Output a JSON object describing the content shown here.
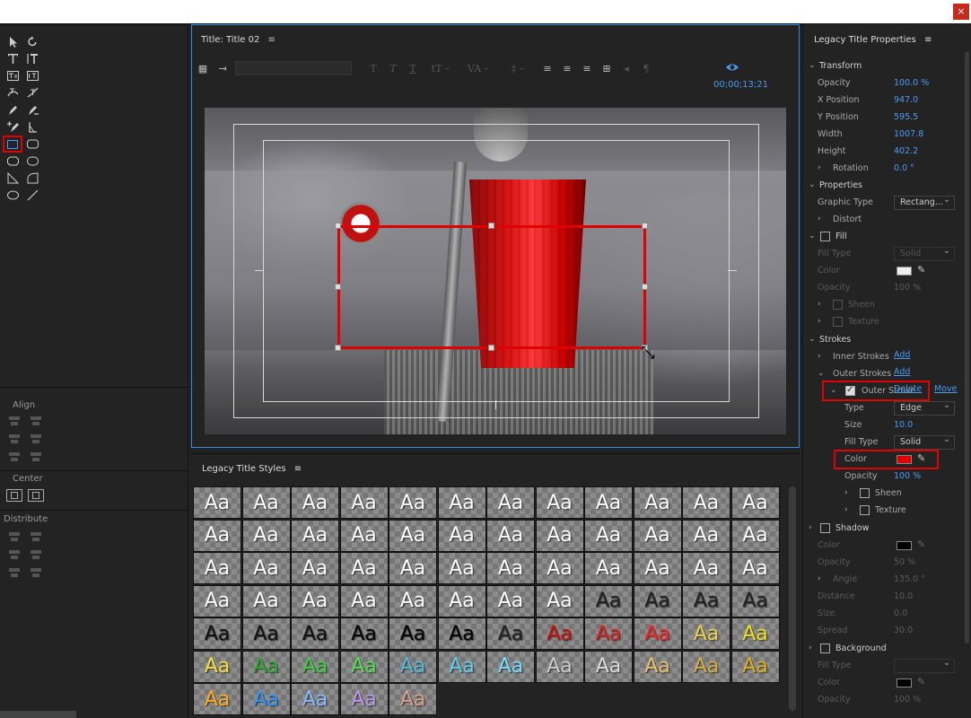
{
  "window": {
    "close_label": "×"
  },
  "tools_panel": {
    "align_label": "Align",
    "center_label": "Center",
    "distribute_label": "Distribute"
  },
  "title_panel": {
    "title": "Title: Title 02",
    "menu_icon": "≡",
    "timecode": "00;00;13;21"
  },
  "styles_panel": {
    "title": "Legacy Title Styles",
    "menu_icon": "≡",
    "swatch_text": "Aa",
    "swatch_colors": [
      "#ffffff",
      "#ffffff",
      "#ffffff",
      "#ffffff",
      "#ffffff",
      "#ffffff",
      "#ffffff",
      "#ffffff",
      "#ffffff",
      "#ffffff",
      "#ffffff",
      "#ffffff",
      "#ffffff",
      "#ffffff",
      "#ffffff",
      "#ffffff",
      "#ffffff",
      "#ffffff",
      "#ffffff",
      "#ffffff",
      "#ffffff",
      "#ffffff",
      "#ffffff",
      "#ffffff",
      "#ffffff",
      "#ffffff",
      "#ffffff",
      "#ffffff",
      "#ffffff",
      "#ffffff",
      "#ffffff",
      "#ffffff",
      "#ffffff",
      "#ffffff",
      "#ffffff",
      "#ffffff",
      "#ffffff",
      "#ffffff",
      "#ffffff",
      "#ffffff",
      "#ffffff",
      "#ffffff",
      "#ffffff",
      "#ffffff",
      "#222222",
      "#222222",
      "#222222",
      "#222222",
      "#111111",
      "#111111",
      "#111111",
      "#000000",
      "#000000",
      "#000000",
      "#222222",
      "#cc1111",
      "#e02020",
      "#ff2222",
      "#f0d050",
      "#f0e020",
      "#f5e040",
      "#33aa33",
      "#44cc44",
      "#55dd55",
      "#55bbdd",
      "#66ccee",
      "#77ddff",
      "#cccccc",
      "#dddddd",
      "#e8c070",
      "#d4b040",
      "#e0b020",
      "#ffb020",
      "#3399ff",
      "#88bbff",
      "#bb99ee",
      "#d8a090"
    ]
  },
  "properties": {
    "title": "Legacy Title Properties",
    "menu_icon": "≡",
    "transform": {
      "label": "Transform",
      "opacity_label": "Opacity",
      "opacity": "100.0 %",
      "x_label": "X Position",
      "x": "947.0",
      "y_label": "Y Position",
      "y": "595.5",
      "width_label": "Width",
      "width": "1007.8",
      "height_label": "Height",
      "height": "402.2",
      "rotation_label": "Rotation",
      "rotation": "0.0 °"
    },
    "props_section": {
      "label": "Properties",
      "graphic_type_label": "Graphic Type",
      "graphic_type": "Rectang...",
      "distort_label": "Distort"
    },
    "fill": {
      "label": "Fill",
      "fill_type_label": "Fill Type",
      "fill_type": "Solid",
      "color_label": "Color",
      "color": "#eeeeee",
      "opacity_label": "Opacity",
      "opacity": "100 %",
      "sheen_label": "Sheen",
      "texture_label": "Texture"
    },
    "strokes": {
      "label": "Strokes",
      "inner_label": "Inner Strokes",
      "inner_add": "Add",
      "outer_label": "Outer Strokes",
      "outer_add": "Add",
      "outer_stroke_label": "Outer Stroke",
      "delete_label": "Delete",
      "move_label": "Move",
      "type_label": "Type",
      "type": "Edge",
      "size_label": "Size",
      "size": "10.0",
      "fill_type_label": "Fill Type",
      "fill_type": "Solid",
      "color_label": "Color",
      "color": "#e00000",
      "opacity_label": "Opacity",
      "opacity": "100 %",
      "sheen_label": "Sheen",
      "texture_label": "Texture"
    },
    "shadow": {
      "label": "Shadow",
      "color_label": "Color",
      "color": "#000000",
      "opacity_label": "Opacity",
      "opacity": "50 %",
      "angle_label": "Angle",
      "angle": "135.0 °",
      "distance_label": "Distance",
      "distance": "10.0",
      "size_label": "Size",
      "size": "0.0",
      "spread_label": "Spread",
      "spread": "30.0"
    },
    "background": {
      "label": "Background",
      "fill_type_label": "Fill Type",
      "fill_type": "",
      "color_label": "Color",
      "color": "#000000",
      "opacity_label": "Opacity",
      "opacity": "100 %"
    }
  }
}
